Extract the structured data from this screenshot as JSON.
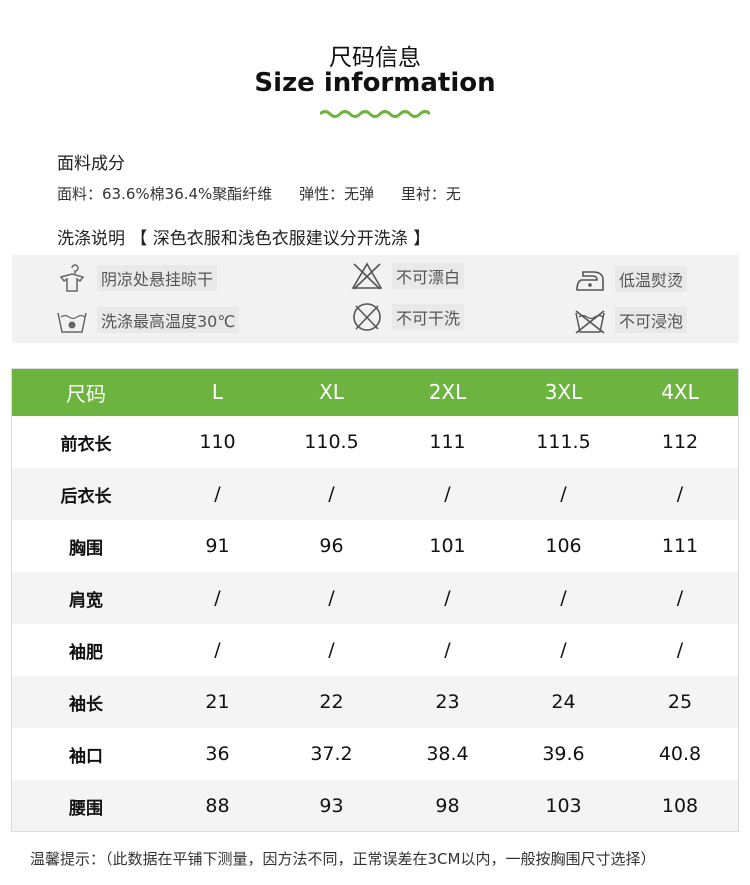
{
  "header": {
    "title_cn": "尺码信息",
    "title_en": "Size information"
  },
  "fabric": {
    "heading": "面料成分",
    "composition": "面料：63.6%棉36.4%聚酯纤维",
    "elasticity": "弹性：无弹",
    "lining": "里衬：无"
  },
  "wash": {
    "heading": "洗涤说明 【 深色衣服和浅色衣服建议分开洗涤 】",
    "items": [
      {
        "label": "阴凉处悬挂晾干",
        "icon": "hang-dry-icon"
      },
      {
        "label": "不可漂白",
        "icon": "no-bleach-icon"
      },
      {
        "label": "低温熨烫",
        "icon": "low-iron-icon"
      },
      {
        "label": "洗涤最高温度30℃",
        "icon": "wash-30-icon"
      },
      {
        "label": "不可干洗",
        "icon": "no-dry-clean-icon"
      },
      {
        "label": "不可浸泡",
        "icon": "no-soak-icon"
      }
    ]
  },
  "size_table": {
    "headers": [
      "尺码",
      "L",
      "XL",
      "2XL",
      "3XL",
      "4XL"
    ],
    "rows": [
      [
        "前衣长",
        "110",
        "110.5",
        "111",
        "111.5",
        "112"
      ],
      [
        "后衣长",
        "/",
        "/",
        "/",
        "/",
        "/"
      ],
      [
        "胸围",
        "91",
        "96",
        "101",
        "106",
        "111"
      ],
      [
        "肩宽",
        "/",
        "/",
        "/",
        "/",
        "/"
      ],
      [
        "袖肥",
        "/",
        "/",
        "/",
        "/",
        "/"
      ],
      [
        "袖长",
        "21",
        "22",
        "23",
        "24",
        "25"
      ],
      [
        "袖口",
        "36",
        "37.2",
        "38.4",
        "39.6",
        "40.8"
      ],
      [
        "腰围",
        "88",
        "93",
        "98",
        "103",
        "108"
      ]
    ]
  },
  "footer": {
    "note": "温馨提示：（此数据在平铺下测量，因方法不同，正常误差在3CM以内，一般按胸围尺寸选择）"
  },
  "colors": {
    "header_green": "#6cb33f",
    "wave_green": "#6cb33f"
  }
}
